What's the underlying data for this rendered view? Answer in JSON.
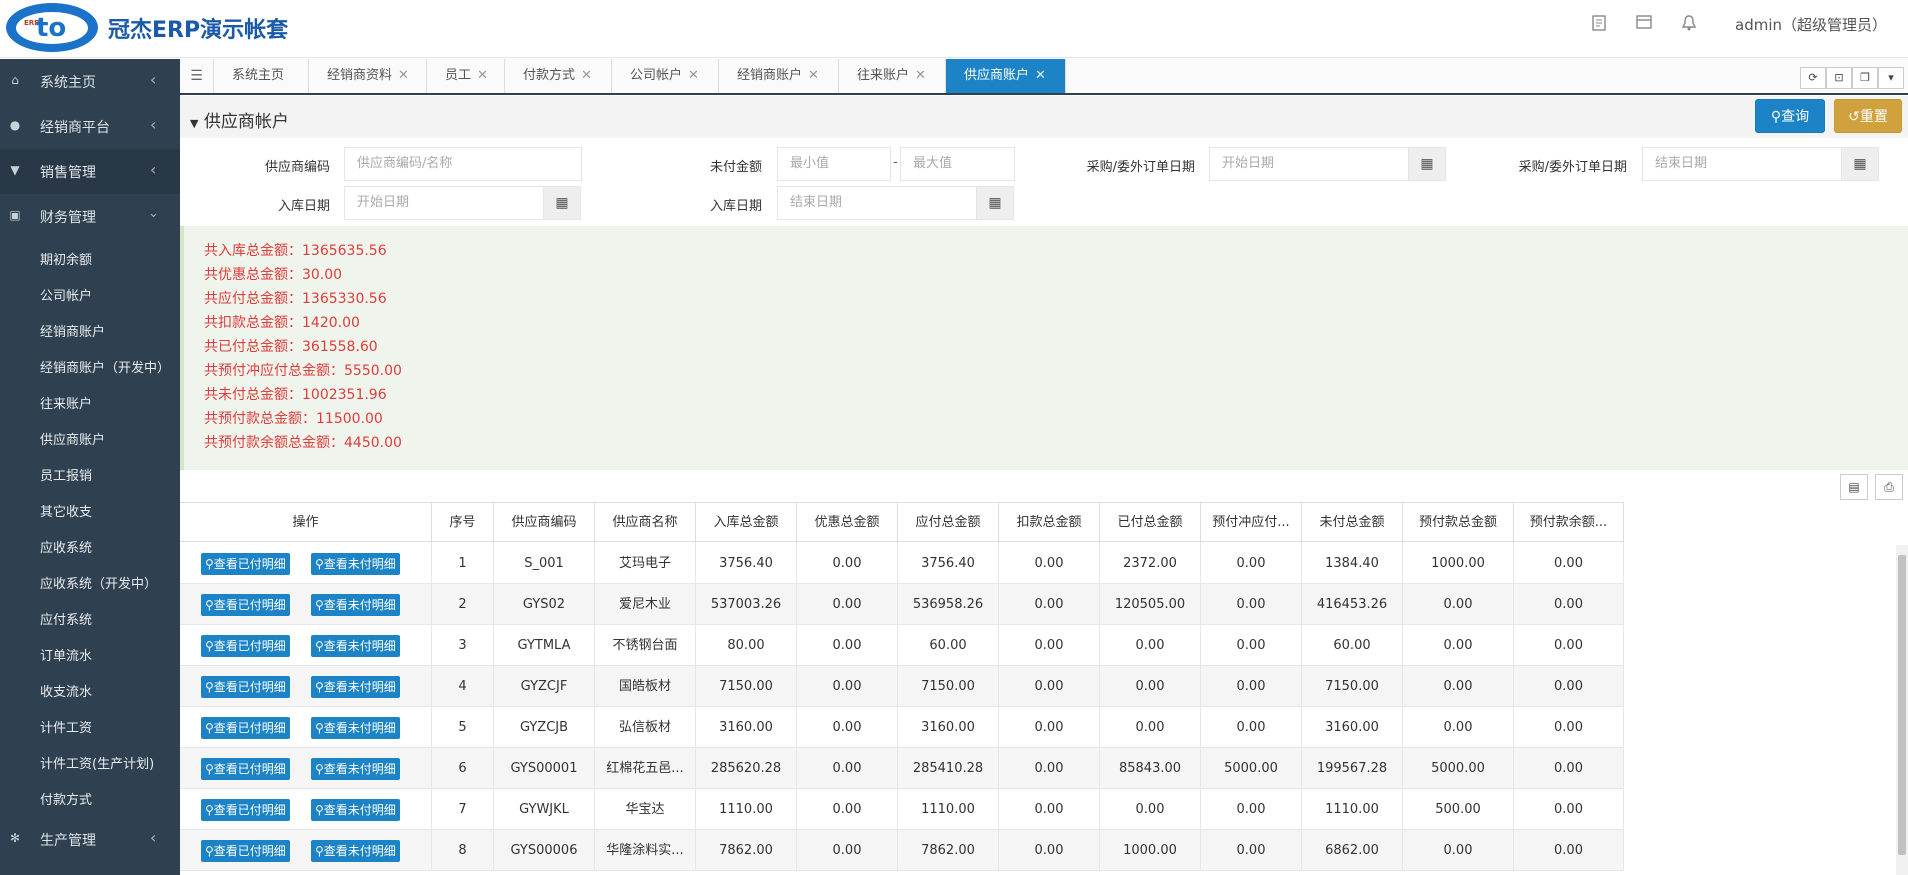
{
  "header": {
    "brand": "冠杰ERP演示帐套",
    "logo_text": "ERP",
    "user": "admin（超级管理员）",
    "icons": [
      "document-icon",
      "card-icon",
      "bell-icon"
    ]
  },
  "sidebar": {
    "top_items": [
      {
        "label": "系统主页",
        "icon": "home-icon"
      },
      {
        "label": "经销商平台",
        "icon": "user-icon"
      },
      {
        "label": "销售管理",
        "icon": "cart-icon"
      },
      {
        "label": "财务管理",
        "icon": "money-icon"
      }
    ],
    "finance_sub": [
      "期初余额",
      "公司帐户",
      "经销商账户",
      "经销商账户（开发中）",
      "往来账户",
      "供应商账户",
      "员工报销",
      "其它收支",
      "应收系统",
      "应收系统（开发中）",
      "应付系统",
      "订单流水",
      "收支流水",
      "计件工资",
      "计件工资(生产计划)",
      "付款方式"
    ],
    "bottom_item": {
      "label": "生产管理",
      "icon": "gear-icon"
    }
  },
  "tabs": [
    "系统主页",
    "经销商资料",
    "员工",
    "付款方式",
    "公司帐户",
    "经销商账户",
    "往来账户",
    "供应商账户"
  ],
  "page": {
    "title": "供应商帐户",
    "query_label": "查询",
    "reset_label": "重置"
  },
  "filters": {
    "supplier_code_label": "供应商编码",
    "supplier_code_placeholder": "供应商编码/名称",
    "unpaid_label": "未付金额",
    "min_placeholder": "最小值",
    "max_placeholder": "最大值",
    "range_sep": "-",
    "order_date_label": "采购/委外订单日期",
    "start_placeholder": "开始日期",
    "end_placeholder": "结束日期",
    "stock_date_label": "入库日期"
  },
  "summary": [
    "共入库总金额：1365635.56",
    "共优惠总金额：30.00",
    "共应付总金额：1365330.56",
    "共扣款总金额：1420.00",
    "共已付总金额：361558.60",
    "共预付冲应付总金额：5550.00",
    "共未付总金额：1002351.96",
    "共预付款总金额：11500.00",
    "共预付款余额总金额：4450.00"
  ],
  "table": {
    "headers": [
      "操作",
      "序号",
      "供应商编码",
      "供应商名称",
      "入库总金额",
      "优惠总金额",
      "应付总金额",
      "扣款总金额",
      "已付总金额",
      "预付冲应付...",
      "未付总金额",
      "预付款总金额",
      "预付款余额..."
    ],
    "btn_paid": "查看已付明细",
    "btn_unpaid": "查看未付明细",
    "rows": [
      [
        "1",
        "S_001",
        "艾玛电子",
        "3756.40",
        "0.00",
        "3756.40",
        "0.00",
        "2372.00",
        "0.00",
        "1384.40",
        "1000.00",
        "0.00"
      ],
      [
        "2",
        "GYS02",
        "爱尼木业",
        "537003.26",
        "0.00",
        "536958.26",
        "0.00",
        "120505.00",
        "0.00",
        "416453.26",
        "0.00",
        "0.00"
      ],
      [
        "3",
        "GYTMLA",
        "不锈钢台面",
        "80.00",
        "0.00",
        "60.00",
        "0.00",
        "0.00",
        "0.00",
        "60.00",
        "0.00",
        "0.00"
      ],
      [
        "4",
        "GYZCJF",
        "国皓板材",
        "7150.00",
        "0.00",
        "7150.00",
        "0.00",
        "0.00",
        "0.00",
        "7150.00",
        "0.00",
        "0.00"
      ],
      [
        "5",
        "GYZCJB",
        "弘信板材",
        "3160.00",
        "0.00",
        "3160.00",
        "0.00",
        "0.00",
        "0.00",
        "3160.00",
        "0.00",
        "0.00"
      ],
      [
        "6",
        "GYS00001",
        "红棉花五邑...",
        "285620.28",
        "0.00",
        "285410.28",
        "0.00",
        "85843.00",
        "5000.00",
        "199567.28",
        "5000.00",
        "0.00"
      ],
      [
        "7",
        "GYWJKL",
        "华宝达",
        "1110.00",
        "0.00",
        "1110.00",
        "0.00",
        "0.00",
        "0.00",
        "1110.00",
        "500.00",
        "0.00"
      ],
      [
        "8",
        "GYS00006",
        "华隆涂料实...",
        "7862.00",
        "0.00",
        "7862.00",
        "0.00",
        "1000.00",
        "0.00",
        "6862.00",
        "0.00",
        "0.00"
      ]
    ]
  }
}
